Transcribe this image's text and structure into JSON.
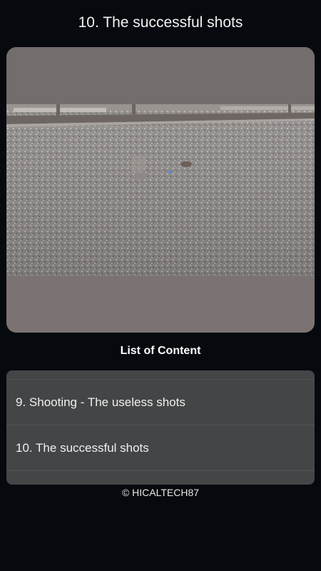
{
  "header": {
    "title": "10. The successful shots"
  },
  "video": {
    "icon": "video-frame"
  },
  "content_list": {
    "heading": "List of Content",
    "items": [
      {
        "label": "9. Shooting - The useless shots"
      },
      {
        "label": "10. The successful shots"
      }
    ]
  },
  "footer": {
    "copyright": "© HICALTECH87"
  },
  "colors": {
    "background": "#06090e",
    "card": "#444546",
    "video_band": "#77706f"
  }
}
